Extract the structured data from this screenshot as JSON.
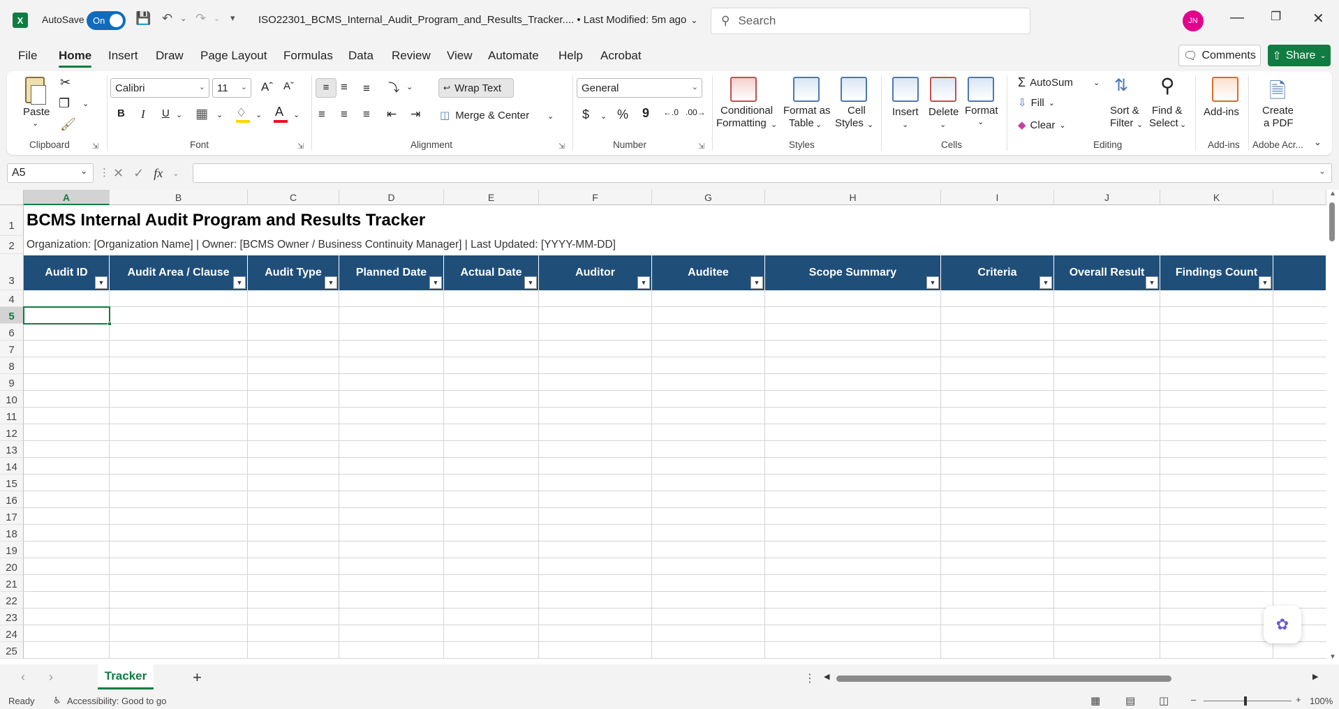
{
  "titlebar": {
    "autosave_label": "AutoSave",
    "autosave_state": "On",
    "document_title": "ISO22301_BCMS_Internal_Audit_Program_and_Results_Tracker....  •  Last Modified: 5m ago",
    "search_placeholder": "Search",
    "user_initials": "JN"
  },
  "menu": {
    "tabs": [
      "File",
      "Home",
      "Insert",
      "Draw",
      "Page Layout",
      "Formulas",
      "Data",
      "Review",
      "View",
      "Automate",
      "Help",
      "Acrobat"
    ],
    "active": "Home",
    "comments_label": "Comments",
    "share_label": "Share"
  },
  "ribbon": {
    "clipboard": {
      "paste": "Paste",
      "group_label": "Clipboard"
    },
    "font": {
      "name": "Calibri",
      "size": "11",
      "group_label": "Font",
      "bold": "B",
      "italic": "I",
      "underline": "U"
    },
    "alignment": {
      "wrap_text": "Wrap Text",
      "merge_center": "Merge & Center",
      "group_label": "Alignment"
    },
    "number": {
      "format": "General",
      "currency": "$",
      "percent": "%",
      "comma": "9",
      "group_label": "Number"
    },
    "styles": {
      "conditional_1": "Conditional",
      "conditional_2": "Formatting",
      "format_table_1": "Format as",
      "format_table_2": "Table",
      "cell_styles_1": "Cell",
      "cell_styles_2": "Styles",
      "group_label": "Styles"
    },
    "cells": {
      "insert": "Insert",
      "delete": "Delete",
      "format": "Format",
      "group_label": "Cells"
    },
    "editing": {
      "autosum": "AutoSum",
      "fill": "Fill",
      "clear": "Clear",
      "sort_1": "Sort &",
      "sort_2": "Filter",
      "find_1": "Find &",
      "find_2": "Select",
      "group_label": "Editing"
    },
    "addins": {
      "label": "Add-ins",
      "group_label": "Add-ins"
    },
    "adobe": {
      "create_1": "Create",
      "create_2": "a PDF",
      "group_label": "Adobe Acr..."
    }
  },
  "formula_bar": {
    "name_box": "A5",
    "fx": "fx",
    "value": ""
  },
  "grid": {
    "columns": [
      "A",
      "B",
      "C",
      "D",
      "E",
      "F",
      "G",
      "H",
      "I",
      "J",
      "K"
    ],
    "selected_column": "A",
    "rows": [
      "1",
      "2",
      "3",
      "4",
      "5",
      "6",
      "7",
      "8",
      "9",
      "10",
      "11",
      "12",
      "13",
      "14",
      "15",
      "16",
      "17",
      "18",
      "19",
      "20",
      "21",
      "22",
      "23",
      "24",
      "25"
    ],
    "selected_row": "5",
    "title": "BCMS Internal Audit Program and Results Tracker",
    "subtitle": "Organization: [Organization Name]   |   Owner: [BCMS Owner / Business Continuity Manager]   |   Last Updated: [YYYY-MM-DD]",
    "headers": [
      "Audit ID",
      "Audit Area / Clause",
      "Audit Type",
      "Planned Date",
      "Actual Date",
      "Auditor",
      "Auditee",
      "Scope Summary",
      "Criteria",
      "Overall Result",
      "Findings Count"
    ],
    "header_color": "#1f4e79"
  },
  "sheets": {
    "tabs": [
      "Tracker"
    ],
    "active": "Tracker"
  },
  "status": {
    "ready": "Ready",
    "accessibility": "Accessibility: Good to go",
    "zoom": "100%"
  }
}
